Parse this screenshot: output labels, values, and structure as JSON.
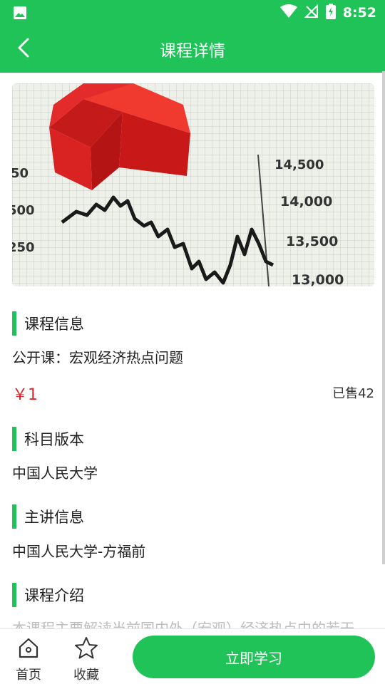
{
  "status_bar": {
    "time": "8:52",
    "icons": [
      "image-icon",
      "wifi-icon",
      "no-signal-icon",
      "battery-charging-icon"
    ]
  },
  "header": {
    "title": "课程详情",
    "back_icon": "chevron-left-icon"
  },
  "banner": {
    "chart_labels": [
      "14,500",
      "14,000",
      "13,500",
      "13,000",
      "50",
      "500",
      "250"
    ]
  },
  "course_info": {
    "heading": "课程信息",
    "name": "公开课：宏观经济热点问题",
    "price": "￥1",
    "sold": "已售42"
  },
  "subject": {
    "heading": "科目版本",
    "value": "中国人民大学"
  },
  "lecturer": {
    "heading": "主讲信息",
    "value": "中国人民大学-方福前"
  },
  "intro": {
    "heading": "课程介绍",
    "text": "本课程主要解读当前国内外（宏观）经济热点中的若干"
  },
  "bottom_nav": {
    "home_label": "首页",
    "favorite_label": "收藏",
    "study_button": "立即学习"
  },
  "colors": {
    "primary": "#1fc357",
    "price": "#e4262b"
  }
}
